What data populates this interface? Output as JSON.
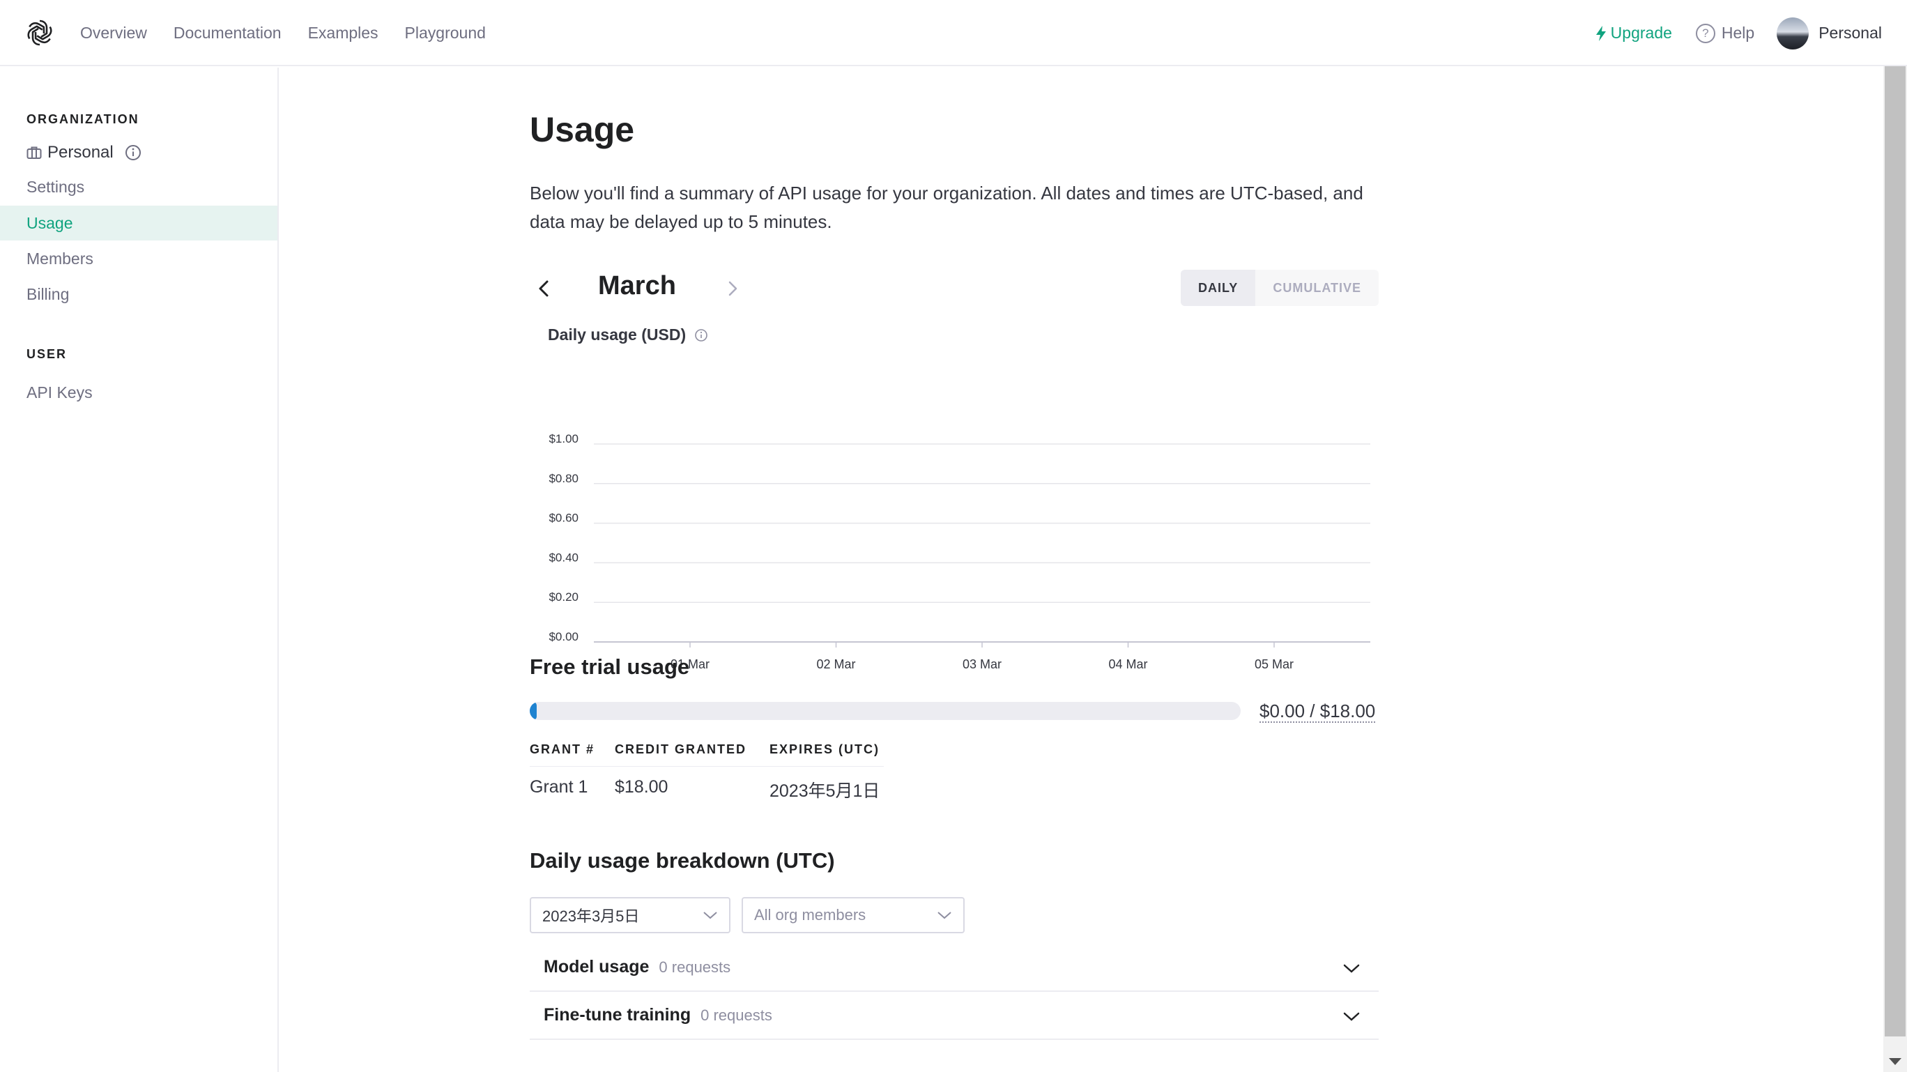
{
  "nav": {
    "links": [
      "Overview",
      "Documentation",
      "Examples",
      "Playground"
    ],
    "upgrade_label": "Upgrade",
    "help_label": "Help",
    "profile_label": "Personal"
  },
  "sidebar": {
    "org_heading": "ORGANIZATION",
    "org_name": "Personal",
    "items": [
      "Settings",
      "Usage",
      "Members",
      "Billing"
    ],
    "active_item": "Usage",
    "user_heading": "USER",
    "user_items": [
      "API Keys"
    ]
  },
  "main": {
    "title": "Usage",
    "description": "Below you'll find a summary of API usage for your organization. All dates and times are UTC-based, and data may be delayed up to 5 minutes.",
    "month": "March",
    "toggle": {
      "daily": "DAILY",
      "cumulative": "CUMULATIVE",
      "selected": "DAILY"
    },
    "chart_title": "Daily usage (USD)",
    "free_trial": {
      "heading": "Free trial usage",
      "used": 0.0,
      "total": 18.0,
      "label": "$0.00 / $18.00"
    },
    "grants": {
      "headers": [
        "GRANT #",
        "CREDIT GRANTED",
        "EXPIRES (UTC)"
      ],
      "rows": [
        [
          "Grant 1",
          "$18.00",
          "2023年5月1日"
        ]
      ]
    },
    "breakdown": {
      "heading": "Daily usage breakdown (UTC)",
      "date_select": "2023年3月5日",
      "member_select": "All org members",
      "rows": [
        {
          "title": "Model usage",
          "count": "0 requests"
        },
        {
          "title": "Fine-tune training",
          "count": "0 requests"
        }
      ]
    }
  },
  "colors": {
    "accent": "#10a37f",
    "progress": "#1f83d0"
  },
  "chart_data": {
    "type": "bar",
    "title": "Daily usage (USD)",
    "categories": [
      "01 Mar",
      "02 Mar",
      "03 Mar",
      "04 Mar",
      "05 Mar"
    ],
    "values": [
      0,
      0,
      0,
      0,
      0
    ],
    "ylim": [
      0,
      1
    ],
    "yticks": [
      "$1.00",
      "$0.80",
      "$0.60",
      "$0.40",
      "$0.20",
      "$0.00"
    ],
    "grid": true
  }
}
